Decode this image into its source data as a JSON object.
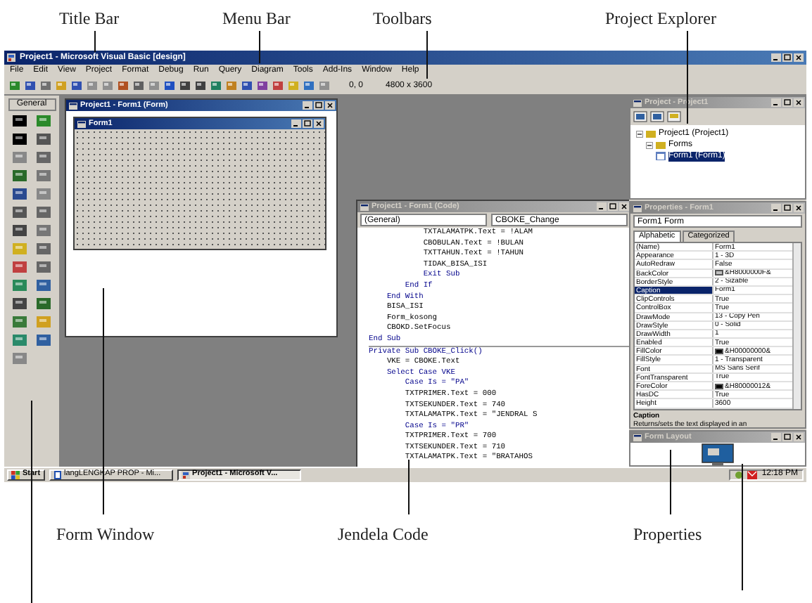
{
  "callouts_top": [
    {
      "label": "Title Bar"
    },
    {
      "label": "Menu Bar"
    },
    {
      "label": "Toolbars"
    },
    {
      "label": "Project Explorer"
    }
  ],
  "callouts_bottom": [
    {
      "label": "Form Window"
    },
    {
      "label": "Jendela Code"
    },
    {
      "label": "Properties"
    }
  ],
  "window": {
    "title": "Project1 - Microsoft Visual Basic [design]"
  },
  "menu": [
    "File",
    "Edit",
    "View",
    "Project",
    "Format",
    "Debug",
    "Run",
    "Query",
    "Diagram",
    "Tools",
    "Add-Ins",
    "Window",
    "Help"
  ],
  "toolbar": {
    "position": "0, 0",
    "size": "4800 x 3600"
  },
  "toolbox": {
    "title": "General"
  },
  "form_designer": {
    "title": "Project1 - Form1 (Form)",
    "active": true,
    "form_title": "Form1"
  },
  "code_window": {
    "title": "Project1 - Form1 (Code)",
    "active": false,
    "object": "(General)",
    "procedure": "CBOKE_Change",
    "lines": [
      {
        "text": "            TXTALAMATPK.Text = !ALAM",
        "kind": "plain"
      },
      {
        "text": "            CBOBULAN.Text = !BULAN",
        "kind": "plain"
      },
      {
        "text": "            TXTTAHUN.Text = !TAHUN",
        "kind": "plain"
      },
      {
        "text": "            TIDAK_BISA_ISI",
        "kind": "plain"
      },
      {
        "text": "            Exit Sub",
        "kind": "keyword"
      },
      {
        "text": "        End If",
        "kind": "keyword"
      },
      {
        "text": "    End With",
        "kind": "keyword"
      },
      {
        "text": "    BISA_ISI",
        "kind": "plain"
      },
      {
        "text": "    Form_kosong",
        "kind": "plain"
      },
      {
        "text": "    CBOKD.SetFocus",
        "kind": "plain"
      },
      {
        "text": "End Sub",
        "kind": "keyword",
        "procedure_end": true
      },
      {
        "text": "Private Sub CBOKE_Click()",
        "kind": "keyword"
      },
      {
        "text": "    VKE = CBOKE.Text",
        "kind": "plain"
      },
      {
        "text": "    Select Case VKE",
        "kind": "keyword"
      },
      {
        "text": "        Case Is = \"PA\"",
        "kind": "keyword"
      },
      {
        "text": "        TXTPRIMER.Text = 000",
        "kind": "plain"
      },
      {
        "text": "        TXTSEKUNDER.Text = 740",
        "kind": "plain"
      },
      {
        "text": "        TXTALAMATPK.Text = \"JENDRAL S",
        "kind": "plain"
      },
      {
        "text": "        Case Is = \"PR\"",
        "kind": "keyword"
      },
      {
        "text": "        TXTPRIMER.Text = 700",
        "kind": "plain"
      },
      {
        "text": "        TXTSEKUNDER.Text = 710",
        "kind": "plain"
      },
      {
        "text": "        TXTALAMATPK.Text = \"BRATAHOS",
        "kind": "plain"
      }
    ]
  },
  "project_explorer": {
    "title": "Project - Project1",
    "active": false,
    "tree": [
      {
        "label": "Project1 (Project1)",
        "expanded": true,
        "children": [
          {
            "label": "Forms",
            "expanded": true,
            "children": [
              {
                "label": "Form1 (Form1)",
                "selected": true
              }
            ]
          }
        ]
      }
    ]
  },
  "properties": {
    "title": "Properties - Form1",
    "active": false,
    "object": "Form1 Form",
    "tabs": [
      {
        "label": "Alphabetic",
        "selected": true
      },
      {
        "label": "Categorized",
        "selected": false
      }
    ],
    "rows": [
      {
        "name": "(Name)",
        "value": "Form1",
        "selected": false
      },
      {
        "name": "Appearance",
        "value": "1 - 3D",
        "selected": false
      },
      {
        "name": "AutoRedraw",
        "value": "False",
        "selected": false
      },
      {
        "name": "BackColor",
        "value": "&H8000000F&",
        "selected": false,
        "color": "#c0c0c0"
      },
      {
        "name": "BorderStyle",
        "value": "2 - Sizable",
        "selected": false
      },
      {
        "name": "Caption",
        "value": "Form1",
        "selected": true
      },
      {
        "name": "ClipControls",
        "value": "True",
        "selected": false
      },
      {
        "name": "ControlBox",
        "value": "True",
        "selected": false
      },
      {
        "name": "DrawMode",
        "value": "13 - Copy Pen",
        "selected": false
      },
      {
        "name": "DrawStyle",
        "value": "0 - Solid",
        "selected": false
      },
      {
        "name": "DrawWidth",
        "value": "1",
        "selected": false
      },
      {
        "name": "Enabled",
        "value": "True",
        "selected": false
      },
      {
        "name": "FillColor",
        "value": "&H00000000&",
        "selected": false,
        "color": "#000000"
      },
      {
        "name": "FillStyle",
        "value": "1 - Transparent",
        "selected": false
      },
      {
        "name": "Font",
        "value": "MS Sans Serif",
        "selected": false
      },
      {
        "name": "FontTransparent",
        "value": "True",
        "selected": false
      },
      {
        "name": "ForeColor",
        "value": "&H80000012&",
        "selected": false,
        "color": "#000000"
      },
      {
        "name": "HasDC",
        "value": "True",
        "selected": false
      },
      {
        "name": "Height",
        "value": "3600",
        "selected": false
      }
    ],
    "description_title": "Caption",
    "description": "Returns/sets the text displayed in an"
  },
  "form_layout": {
    "title": "Form Layout",
    "active": false
  },
  "taskbar": {
    "start": "Start",
    "tasks": [
      {
        "label": "langLENGKAP PROP - Mi...",
        "selected": false
      },
      {
        "label": "Project1 - Microsoft V...",
        "selected": true
      }
    ],
    "clock": "12:18 PM"
  }
}
